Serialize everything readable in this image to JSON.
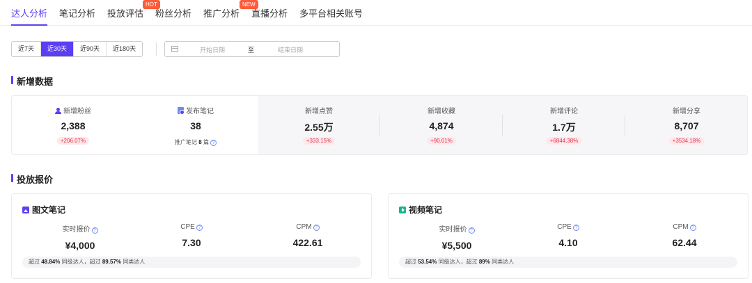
{
  "tabs": [
    {
      "label": "达人分析",
      "badge": ""
    },
    {
      "label": "笔记分析",
      "badge": ""
    },
    {
      "label": "投放评估",
      "badge": "HOT"
    },
    {
      "label": "粉丝分析",
      "badge": ""
    },
    {
      "label": "推广分析",
      "badge": "NEW"
    },
    {
      "label": "直播分析",
      "badge": ""
    },
    {
      "label": "多平台相关账号",
      "badge": ""
    }
  ],
  "range_options": [
    "近7天",
    "近30天",
    "近90天",
    "近180天"
  ],
  "range_selected": "近30天",
  "date_range": {
    "start_placeholder": "开始日期",
    "separator": "至",
    "end_placeholder": "结束日期"
  },
  "section_new": {
    "title": "新增数据"
  },
  "stats": [
    {
      "label": "新增粉丝",
      "value": "2,388",
      "delta": "+206.07%",
      "icon": "user-icon"
    },
    {
      "label": "发布笔记",
      "value": "38",
      "sub_prefix": "推广笔记",
      "sub_num": "8",
      "sub_suffix": "篇",
      "icon": "note-icon"
    },
    {
      "label": "新增点赞",
      "value": "2.55万",
      "delta": "+333.15%"
    },
    {
      "label": "新增收藏",
      "value": "4,874",
      "delta": "+90.01%"
    },
    {
      "label": "新增评论",
      "value": "1.7万",
      "delta": "+6844.38%"
    },
    {
      "label": "新增分享",
      "value": "8,707",
      "delta": "+3534.18%"
    }
  ],
  "section_price": {
    "title": "投放报价"
  },
  "cards": [
    {
      "title": "图文笔记",
      "icon": "image-note-icon",
      "metrics": [
        {
          "label": "实时报价",
          "value": "¥4,000"
        },
        {
          "label": "CPE",
          "value": "7.30"
        },
        {
          "label": "CPM",
          "value": "422.61"
        }
      ],
      "foot": {
        "p1": "超过",
        "v1": "48.84%",
        "p2": "同级达人，超过",
        "v2": "89.57%",
        "p3": "同类达人"
      }
    },
    {
      "title": "视频笔记",
      "icon": "video-note-icon",
      "metrics": [
        {
          "label": "实时报价",
          "value": "¥5,500"
        },
        {
          "label": "CPE",
          "value": "4.10"
        },
        {
          "label": "CPM",
          "value": "62.44"
        }
      ],
      "foot": {
        "p1": "超过",
        "v1": "53.54%",
        "p2": "同级达人，超过",
        "v2": "89%",
        "p3": "同类达人"
      }
    }
  ],
  "colors": {
    "accent": "#5b3ff2",
    "delta_red": "#e8334a",
    "hot": "#ff5b3a"
  }
}
